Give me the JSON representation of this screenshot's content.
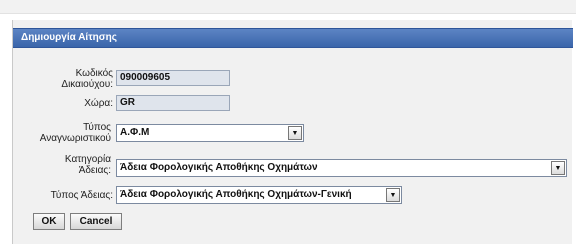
{
  "header": {
    "title": "Δημιουργία Αίτησης"
  },
  "form": {
    "holder_code": {
      "label": "Κωδικός Δικαιούχου:",
      "value": "090009605"
    },
    "country": {
      "label": "Χώρα:",
      "value": "GR"
    },
    "id_type": {
      "label": "Τύπος Αναγνωριστικού",
      "value": "Α.Φ.Μ"
    },
    "license_category": {
      "label": "Κατηγορία Άδειας:",
      "value": "Άδεια Φορολογικής Αποθήκης Οχημάτων"
    },
    "license_type": {
      "label": "Τύπος Άδειας:",
      "value": "Άδεια Φορολογικής Αποθήκης Οχημάτων-Γενική"
    }
  },
  "buttons": {
    "ok": "OK",
    "cancel": "Cancel"
  },
  "icons": {
    "dropdown": "chevron-down-icon"
  }
}
